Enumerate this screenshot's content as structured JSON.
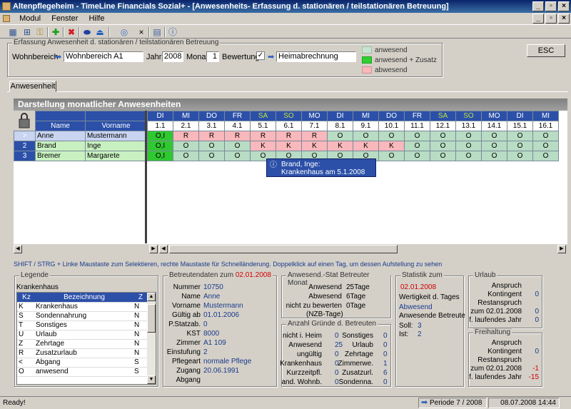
{
  "window": {
    "title": "Altenpflegeheim - TimeLine Financials Sozial+ - [Anwesenheits- Erfassung  d. stationären / teilstationären Betreuung]"
  },
  "menu": [
    "Modul",
    "Fenster",
    "Hilfe"
  ],
  "filter": {
    "group_title": "Erfassung Anwesenheit  d. stationären / teilstationären Betreuung",
    "wohnbereich_label": "Wohnbereich",
    "wohnbereich_value": "Wohnbereich A1",
    "jahr_label": "Jahr",
    "jahr_value": "2008",
    "monat_label": "Monat",
    "monat_value": "1",
    "bewertung_label": "Bewertung",
    "bewertung_value": "Heimabrechnung",
    "esc_label": "ESC"
  },
  "color_legend": [
    {
      "label": "anwesend",
      "color": "#c8e4d0"
    },
    {
      "label": "anwesend + Zusatz",
      "color": "#30d030"
    },
    {
      "label": "abwesend",
      "color": "#f8b8bc"
    }
  ],
  "tab_label": "Anwesenheit",
  "grid": {
    "title": "Darstellung monatlicher Anwesenheiten",
    "name_header": "Name",
    "vorname_header": "Vorname",
    "days": [
      {
        "d": "DI",
        "n": "1.1"
      },
      {
        "d": "MI",
        "n": "2.1"
      },
      {
        "d": "DO",
        "n": "3.1"
      },
      {
        "d": "FR",
        "n": "4.1"
      },
      {
        "d": "SA",
        "n": "5.1"
      },
      {
        "d": "SO",
        "n": "6.1"
      },
      {
        "d": "MO",
        "n": "7.1"
      },
      {
        "d": "DI",
        "n": "8.1"
      },
      {
        "d": "MI",
        "n": "9.1"
      },
      {
        "d": "DO",
        "n": "10.1"
      },
      {
        "d": "FR",
        "n": "11.1"
      },
      {
        "d": "SA",
        "n": "12.1"
      },
      {
        "d": "SO",
        "n": "13.1"
      },
      {
        "d": "MO",
        "n": "14.1"
      },
      {
        "d": "DI",
        "n": "15.1"
      },
      {
        "d": "MI",
        "n": "16.1"
      }
    ],
    "rows": [
      {
        "idx": ">",
        "name": "Anne",
        "vorname": "Mustermann",
        "cells": [
          "O,I",
          "R",
          "R",
          "R",
          "R",
          "R",
          "R",
          "O",
          "O",
          "O",
          "O",
          "O",
          "O",
          "O",
          "O",
          "O"
        ]
      },
      {
        "idx": "2",
        "name": "Brand",
        "vorname": "Inge",
        "cells": [
          "O,I",
          "O",
          "O",
          "O",
          "K",
          "K",
          "K",
          "K",
          "K",
          "K",
          "O",
          "O",
          "O",
          "O",
          "O",
          "O"
        ]
      },
      {
        "idx": "3",
        "name": "Bremer",
        "vorname": "Margarete",
        "cells": [
          "O,I",
          "O",
          "O",
          "O",
          "O",
          "O",
          "O",
          "O",
          "O",
          "O",
          "O",
          "O",
          "O",
          "O",
          "O",
          "O"
        ]
      }
    ],
    "tooltip": {
      "line1": "Brand, Inge:",
      "line2": "Krankenhaus am 5.1.2008"
    },
    "hint": "SHIFT / STRG + Linke Maustaste zum Selektieren, rechte Maustaste für Schnelländerung.  Doppelklick auf einen Tag, um dessen Aufstellung zu sehen"
  },
  "legend": {
    "title": "Legende",
    "current": "Krankenhaus",
    "kz_header": "Kz",
    "bez_header": "Bezeichnung",
    "z_header": "Z",
    "rows": [
      {
        "kz": "K",
        "bez": "Krankenhaus",
        "z": "N"
      },
      {
        "kz": "S",
        "bez": "Sondennahrung",
        "z": "N"
      },
      {
        "kz": "T",
        "bez": "Sonstiges",
        "z": "N"
      },
      {
        "kz": "U",
        "bez": "Urlaub",
        "z": "N"
      },
      {
        "kz": "Z",
        "bez": "Zehrtage",
        "z": "N"
      },
      {
        "kz": "R",
        "bez": "Zusatzurlaub",
        "z": "N"
      },
      {
        "kz": "<",
        "bez": "Abgang",
        "z": "S"
      },
      {
        "kz": "O",
        "bez": "anwesend",
        "z": "S"
      }
    ]
  },
  "betreuten": {
    "title": "Betreutendaten zum",
    "date": "02.01.2008",
    "fields": [
      {
        "l": "Nummer",
        "v": "10750"
      },
      {
        "l": "Name",
        "v": "Anne"
      },
      {
        "l": "Vorname",
        "v": "Mustermann"
      },
      {
        "l": "Gültig ab",
        "v": "01.01.2006"
      },
      {
        "l": "P.Statzab.",
        "v": "0"
      },
      {
        "l": "KST",
        "v": "8000"
      },
      {
        "l": "Zimmer",
        "v": "A1 109"
      },
      {
        "l": "Einstufung",
        "v": "2"
      },
      {
        "l": "Pflegeart",
        "v": "normale Pflege"
      },
      {
        "l": "Zugang",
        "v": "20.06.1991"
      },
      {
        "l": "Abgang",
        "v": ""
      }
    ]
  },
  "anwesend_stat": {
    "title": "Anwesend.-Stat Betreuter Monat",
    "rows": [
      {
        "l": "Anwesend",
        "v": "25Tage"
      },
      {
        "l": "Abwesend",
        "v": "6Tage"
      },
      {
        "l": "nicht zu bewerten",
        "v": "0Tage"
      }
    ],
    "note": "(NZB-Tage)"
  },
  "gruende": {
    "title": "Anzahl Gründe d. Betreuten",
    "rows": [
      {
        "l1": "nicht i. Heim",
        "v1": "0",
        "l2": "Sonstiges",
        "v2": "0"
      },
      {
        "l1": "Anwesend",
        "v1": "25",
        "l2": "Urlaub",
        "v2": "0"
      },
      {
        "l1": "ungültig",
        "v1": "0",
        "l2": "Zehrtage",
        "v2": "0"
      },
      {
        "l1": "Krankenhaus",
        "v1": "0",
        "l2": "Zimmerwe.",
        "v2": "1"
      },
      {
        "l1": "Kurzzeitpfl.",
        "v1": "0",
        "l2": "Zusatzurl.",
        "v2": "6"
      },
      {
        "l1": "and. Wohnb.",
        "v1": "0",
        "l2": "Sondenna.",
        "v2": "0"
      }
    ]
  },
  "statistik": {
    "title": "Statistik zum",
    "date": "02.01.2008",
    "wertigkeit": "Wertigkeit d. Tages",
    "wert_value": "Abwesend",
    "betreute": "Anwesende Betreute",
    "soll_label": "Soll:",
    "soll_value": "3",
    "ist_label": "Ist:",
    "ist_value": "2"
  },
  "urlaub": {
    "title": "Urlaub",
    "rows": [
      {
        "l": "Anspruch",
        "v": ""
      },
      {
        "l": "Kontingent",
        "v": "0"
      },
      {
        "l": "Restanspruch",
        "v": ""
      },
      {
        "l": "zum 02.01.2008",
        "v": "0"
      },
      {
        "l": "f. laufendes Jahr",
        "v": "0"
      }
    ]
  },
  "freihaltung": {
    "title": "Freihaltung",
    "rows": [
      {
        "l": "Anspruch",
        "v": ""
      },
      {
        "l": "Kontingent",
        "v": "0"
      },
      {
        "l": "Restanspruch",
        "v": ""
      },
      {
        "l": "zum 02.01.2008",
        "v": "-1"
      },
      {
        "l": "f. laufendes Jahr",
        "v": "-15"
      }
    ]
  },
  "status": {
    "ready": "Ready!",
    "periode": "Periode 7  / 2008",
    "datetime": "08.07.2008 14:44"
  }
}
